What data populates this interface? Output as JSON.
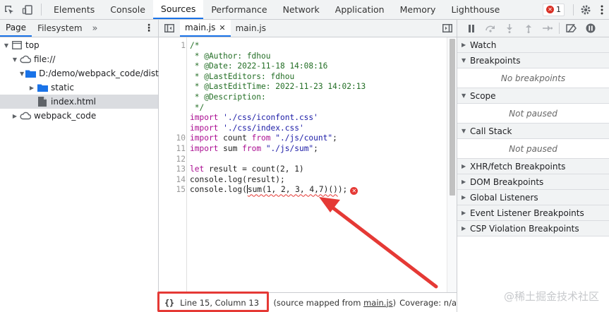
{
  "topbar": {
    "tabs": [
      "Elements",
      "Console",
      "Sources",
      "Performance",
      "Network",
      "Application",
      "Memory",
      "Lighthouse"
    ],
    "active_tab": "Sources",
    "error_count": "1"
  },
  "navigator": {
    "tabs": [
      "Page",
      "Filesystem"
    ],
    "more": "»",
    "tree": [
      {
        "label": "top",
        "depth": 0,
        "expanded": true,
        "icon": "frame-icon"
      },
      {
        "label": "file://",
        "depth": 1,
        "expanded": true,
        "icon": "cloud-icon"
      },
      {
        "label": "D:/demo/webpack_code/dist",
        "depth": 2,
        "expanded": true,
        "icon": "folder-icon"
      },
      {
        "label": "static",
        "depth": 3,
        "expanded": false,
        "icon": "folder-icon"
      },
      {
        "label": "index.html",
        "depth": 3,
        "expanded": null,
        "icon": "file-icon",
        "selected": true
      },
      {
        "label": "webpack_code",
        "depth": 1,
        "expanded": false,
        "icon": "cloud-icon"
      }
    ]
  },
  "editor": {
    "tabs": [
      {
        "label": "main.js",
        "active": true,
        "closable": true
      },
      {
        "label": "main.js",
        "active": false,
        "closable": false
      }
    ],
    "lines": [
      {
        "num": "1",
        "parts": [
          {
            "t": "/*",
            "c": "com"
          }
        ]
      },
      {
        "num": "",
        "parts": [
          {
            "t": " * @Author: fdhou",
            "c": "com"
          }
        ]
      },
      {
        "num": "",
        "parts": [
          {
            "t": " * @Date: 2022-11-18 14:08:16",
            "c": "com"
          }
        ]
      },
      {
        "num": "",
        "parts": [
          {
            "t": " * @LastEditors: fdhou",
            "c": "com"
          }
        ]
      },
      {
        "num": "",
        "parts": [
          {
            "t": " * @LastEditTime: 2022-11-23 14:02:13",
            "c": "com"
          }
        ]
      },
      {
        "num": "",
        "parts": [
          {
            "t": " * @Description:",
            "c": "com"
          }
        ]
      },
      {
        "num": "",
        "parts": [
          {
            "t": " */",
            "c": "com"
          }
        ]
      },
      {
        "num": "",
        "parts": [
          {
            "t": "import",
            "c": "kw"
          },
          {
            "t": " ",
            "c": "def"
          },
          {
            "t": "'./css/iconfont.css'",
            "c": "str"
          }
        ]
      },
      {
        "num": "",
        "parts": [
          {
            "t": "import",
            "c": "kw"
          },
          {
            "t": " ",
            "c": "def"
          },
          {
            "t": "'./css/index.css'",
            "c": "str"
          }
        ]
      },
      {
        "num": "10",
        "parts": [
          {
            "t": "import",
            "c": "kw"
          },
          {
            "t": " count ",
            "c": "def"
          },
          {
            "t": "from",
            "c": "kw"
          },
          {
            "t": " ",
            "c": "def"
          },
          {
            "t": "\"./js/count\"",
            "c": "str"
          },
          {
            "t": ";",
            "c": "def"
          }
        ]
      },
      {
        "num": "11",
        "parts": [
          {
            "t": "import",
            "c": "kw"
          },
          {
            "t": " sum ",
            "c": "def"
          },
          {
            "t": "from",
            "c": "kw"
          },
          {
            "t": " ",
            "c": "def"
          },
          {
            "t": "\"./js/sum\"",
            "c": "str"
          },
          {
            "t": ";",
            "c": "def"
          }
        ]
      },
      {
        "num": "12",
        "parts": [
          {
            "t": "",
            "c": "def"
          }
        ]
      },
      {
        "num": "13",
        "parts": [
          {
            "t": "let",
            "c": "kw"
          },
          {
            "t": " result = count(2, 1)",
            "c": "def"
          }
        ]
      },
      {
        "num": "14",
        "parts": [
          {
            "t": "console.log(result);",
            "c": "def"
          }
        ]
      },
      {
        "num": "15",
        "parts": [
          {
            "t": "console.log(",
            "c": "def"
          },
          {
            "t": "|",
            "c": "caret"
          },
          {
            "t": "sum(1, 2, 3, 4,7)()",
            "c": "err"
          },
          {
            "t": ");",
            "c": "def"
          }
        ],
        "error": true
      }
    ],
    "error_marker": "✕"
  },
  "status": {
    "pretty_print": "{}",
    "position": "Line 15, Column 13",
    "source_prefix": "(source mapped from ",
    "source_link": "main.js",
    "source_suffix": ")",
    "coverage": "Coverage: n/a"
  },
  "debugger": {
    "panes": [
      {
        "title": "Watch",
        "expanded": false,
        "body": ""
      },
      {
        "title": "Breakpoints",
        "expanded": true,
        "body": "No breakpoints"
      },
      {
        "title": "Scope",
        "expanded": true,
        "body": "Not paused"
      },
      {
        "title": "Call Stack",
        "expanded": true,
        "body": "Not paused"
      },
      {
        "title": "XHR/fetch Breakpoints",
        "expanded": false,
        "body": ""
      },
      {
        "title": "DOM Breakpoints",
        "expanded": false,
        "body": ""
      },
      {
        "title": "Global Listeners",
        "expanded": false,
        "body": ""
      },
      {
        "title": "Event Listener Breakpoints",
        "expanded": false,
        "body": ""
      },
      {
        "title": "CSP Violation Breakpoints",
        "expanded": false,
        "body": ""
      }
    ]
  },
  "watermark": "@稀土掘金技术社区",
  "colors": {
    "accent": "#1a73e8",
    "error": "#e53935",
    "annotation": "#e53935"
  }
}
